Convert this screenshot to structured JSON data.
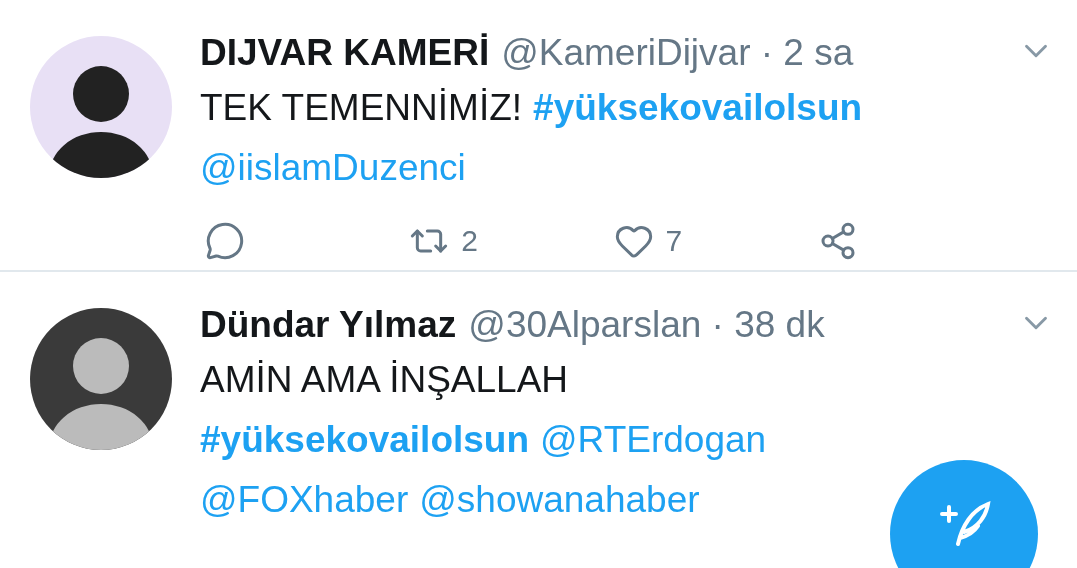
{
  "tweets": [
    {
      "name": "DIJVAR KAMERİ",
      "meta": "@KameriDijvar · 2 sa",
      "lines": [
        [
          {
            "kind": "text",
            "text": "TEK TEMENNİMİZ!"
          },
          {
            "kind": "hashtag",
            "text": "#yüksekovailolsun"
          }
        ],
        [
          {
            "kind": "mention",
            "text": "@iislamDuzenci"
          }
        ]
      ],
      "actions": [
        {
          "kind": "reply"
        },
        {
          "kind": "retweet",
          "count": "2"
        },
        {
          "kind": "like",
          "count": "7"
        },
        {
          "kind": "share"
        }
      ]
    },
    {
      "name": "Dündar Yılmaz",
      "meta": "@30Alparslan · 38 dk",
      "lines": [
        [
          {
            "kind": "text",
            "text": "AMİN AMA İNŞALLAH"
          }
        ],
        [
          {
            "kind": "hashtag",
            "text": "#yüksekovailolsun"
          },
          {
            "kind": "mention",
            "text": "@RTErdogan"
          }
        ],
        [
          {
            "kind": "mention",
            "text": "@FOXhaber"
          },
          {
            "kind": "mention",
            "text": "@showanahaber"
          }
        ]
      ]
    }
  ]
}
